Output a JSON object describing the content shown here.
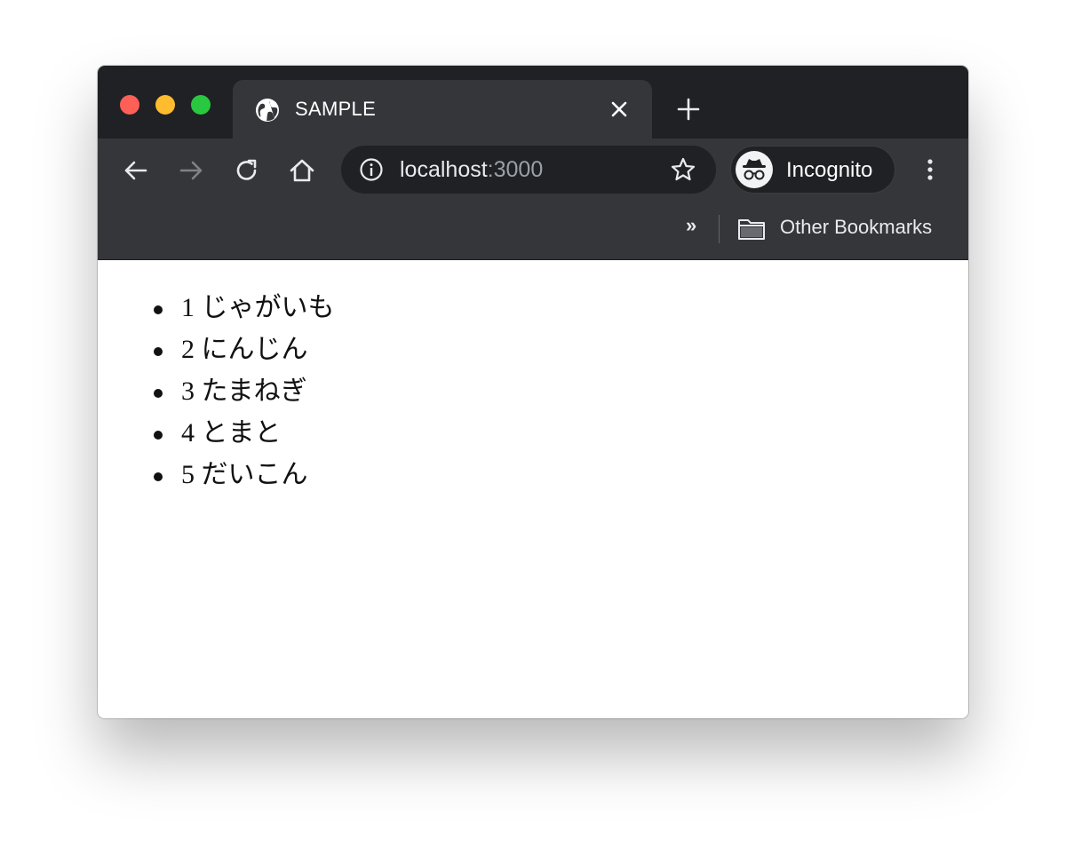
{
  "tab": {
    "title": "SAMPLE",
    "favicon": "globe-icon"
  },
  "omnibox": {
    "host": "localhost",
    "port": ":3000"
  },
  "profile": {
    "label": "Incognito"
  },
  "bookmarks": {
    "overflow": "»",
    "folder_label": "Other Bookmarks"
  },
  "list_items": [
    "1 じゃがいも",
    "2 にんじん",
    "3 たまねぎ",
    "4 とまと",
    "5 だいこん"
  ],
  "colors": {
    "titlebar": "#202124",
    "toolbar": "#35363a",
    "close": "#fe5f57",
    "minimize": "#febc2e",
    "maximize": "#28c840"
  }
}
